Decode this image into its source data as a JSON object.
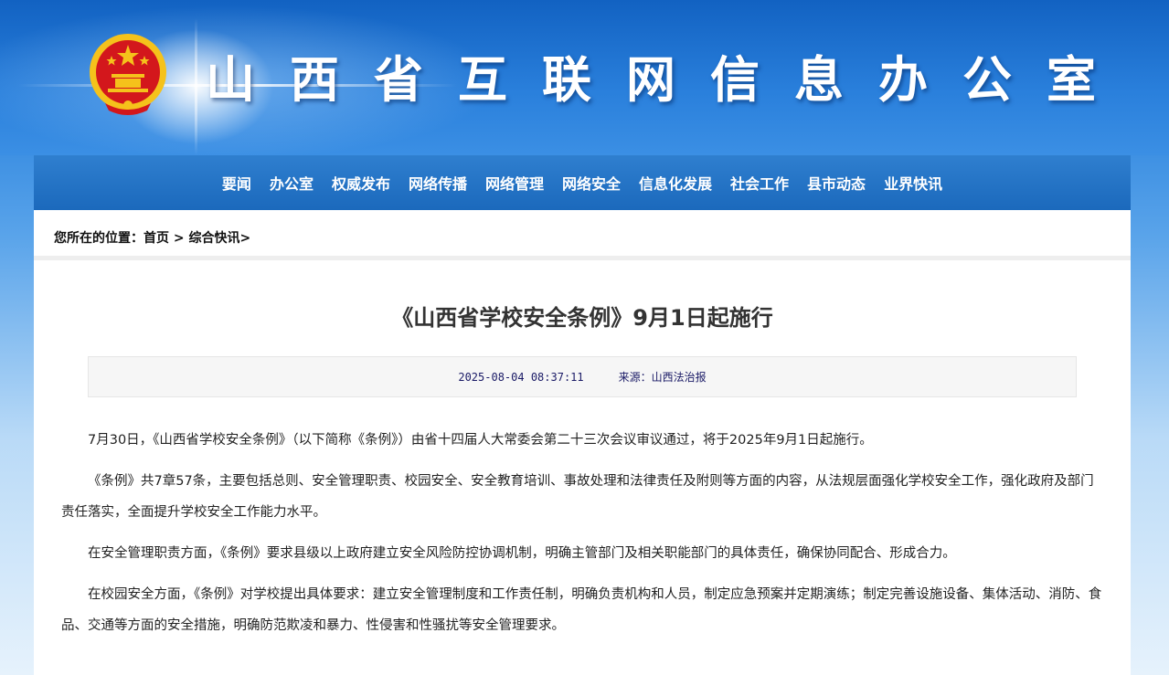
{
  "header": {
    "site_title": "山西省互联网信息办公室",
    "emblem": "national-emblem"
  },
  "nav": {
    "items": [
      "要闻",
      "办公室",
      "权威发布",
      "网络传播",
      "网络管理",
      "网络安全",
      "信息化发展",
      "社会工作",
      "县市动态",
      "业界快讯"
    ]
  },
  "breadcrumb": {
    "prefix": "您所在的位置：",
    "home": "首页",
    "sep1": " > ",
    "section": "综合快讯",
    "sep2": ">"
  },
  "article": {
    "title": "《山西省学校安全条例》9月1日起施行",
    "datetime": "2025-08-04 08:37:11",
    "source": "来源：山西法治报",
    "paragraphs": [
      "7月30日，《山西省学校安全条例》（以下简称《条例》）由省十四届人大常委会第二十三次会议审议通过，将于2025年9月1日起施行。",
      "《条例》共7章57条，主要包括总则、安全管理职责、校园安全、安全教育培训、事故处理和法律责任及附则等方面的内容，从法规层面强化学校安全工作，强化政府及部门责任落实，全面提升学校安全工作能力水平。",
      "在安全管理职责方面，《条例》要求县级以上政府建立安全风险防控协调机制，明确主管部门及相关职能部门的具体责任，确保协同配合、形成合力。",
      "在校园安全方面，《条例》对学校提出具体要求：建立安全管理制度和工作责任制，明确负责机构和人员，制定应急预案并定期演练；制定完善设施设备、集体活动、消防、食品、交通等方面的安全措施，明确防范欺凌和暴力、性侵害和性骚扰等安全管理要求。"
    ]
  },
  "colors": {
    "nav_bg": "#1b69bc",
    "banner_bg": "#2a80dc",
    "emblem_red": "#d3171c",
    "emblem_gold": "#f5c21b"
  }
}
